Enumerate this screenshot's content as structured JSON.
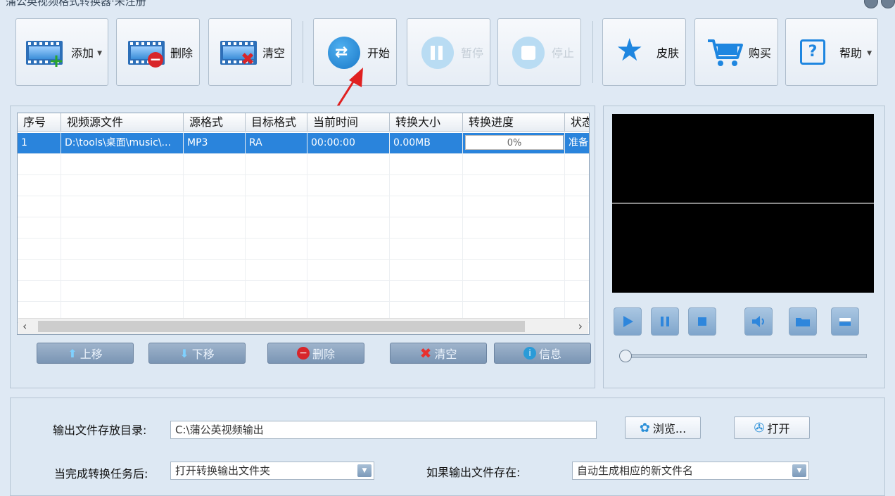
{
  "window": {
    "title": "蒲公英视频格式转换器·未注册"
  },
  "toolbar": {
    "add": "添加",
    "delete": "删除",
    "clear": "清空",
    "start": "开始",
    "pause": "暂停",
    "stop": "停止",
    "skin": "皮肤",
    "buy": "购买",
    "help": "帮助"
  },
  "table": {
    "columns": [
      "序号",
      "视频源文件",
      "源格式",
      "目标格式",
      "当前时间",
      "转换大小",
      "转换进度",
      "状态"
    ],
    "rows": [
      {
        "index": "1",
        "source": "D:\\tools\\桌面\\music\\...",
        "src_format": "MP3",
        "dst_format": "RA",
        "time": "00:00:00",
        "size": "0.00MB",
        "progress_text": "0%",
        "status": "准备"
      }
    ]
  },
  "list_buttons": {
    "up": "上移",
    "down": "下移",
    "delete": "删除",
    "clear": "清空",
    "info": "信息"
  },
  "output": {
    "dir_label": "输出文件存放目录:",
    "dir_value": "C:\\蒲公英视频输出",
    "browse": "浏览...",
    "open": "打开",
    "after_label": "当完成转换任务后:",
    "after_value": "打开转换输出文件夹",
    "exists_label": "如果输出文件存在:",
    "exists_value": "自动生成相应的新文件名"
  },
  "colors": {
    "accent": "#2a84dc",
    "arrow": "#e02020"
  }
}
